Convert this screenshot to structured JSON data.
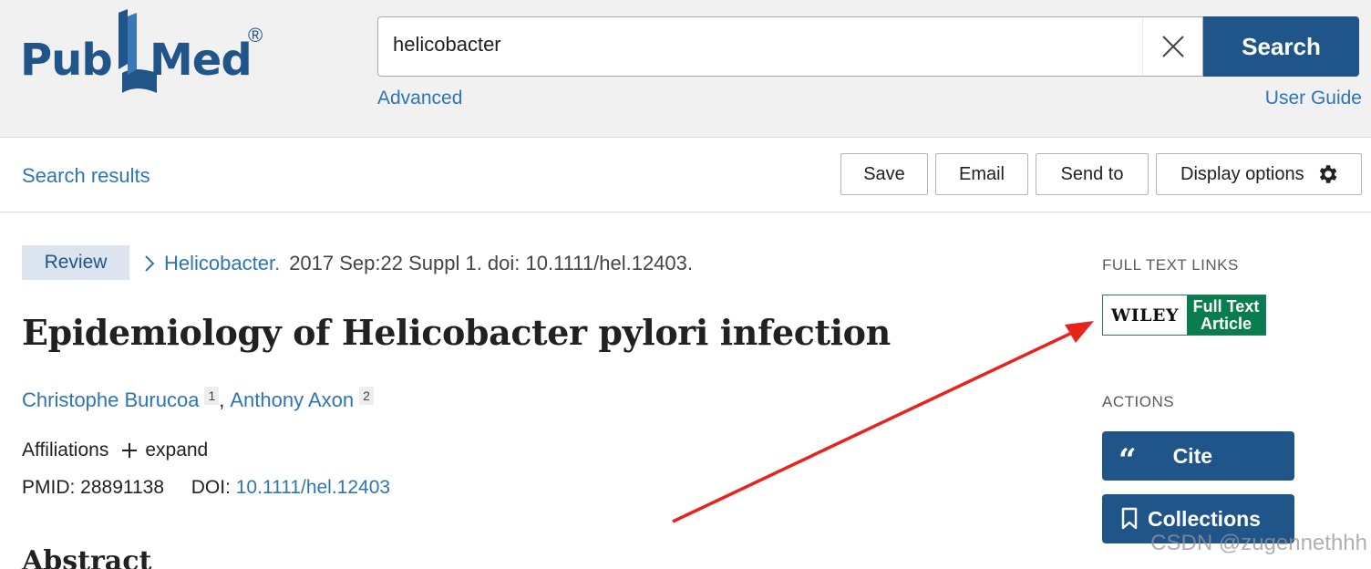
{
  "header": {
    "logo_pub": "Pub",
    "logo_med": "Med",
    "logo_reg": "®",
    "search_value": "helicobacter",
    "search_button": "Search",
    "advanced_link": "Advanced",
    "user_guide_link": "User Guide"
  },
  "toolbar": {
    "results_link": "Search results",
    "save": "Save",
    "email": "Email",
    "send_to": "Send to",
    "display_options": "Display options"
  },
  "article": {
    "type_badge": "Review",
    "journal": "Helicobacter.",
    "citation": "2017 Sep:22 Suppl 1. doi: 10.1111/hel.12403.",
    "title": "Epidemiology of Helicobacter pylori infection",
    "authors": [
      {
        "name": "Christophe Burucoa",
        "sup": "1"
      },
      {
        "name": "Anthony Axon",
        "sup": "2"
      }
    ],
    "affiliations_label": "Affiliations",
    "expand_label": "expand",
    "pmid_label": "PMID: 28891138",
    "doi_label": "DOI:",
    "doi_value": "10.1111/hel.12403",
    "abstract_heading": "Abstract"
  },
  "sidebar": {
    "full_text_heading": "FULL TEXT LINKS",
    "wiley_logo": "WILEY",
    "wiley_line1": "Full Text",
    "wiley_line2": "Article",
    "actions_heading": "ACTIONS",
    "cite": "Cite",
    "cite_glyph": "“",
    "collections": "Collections"
  },
  "watermark": "CSDN @zugennethhh",
  "colors": {
    "brand_blue": "#20558a",
    "link_blue": "#2e75b6",
    "wiley_green": "#0a7d4f",
    "annotation_red": "#e8231c"
  }
}
